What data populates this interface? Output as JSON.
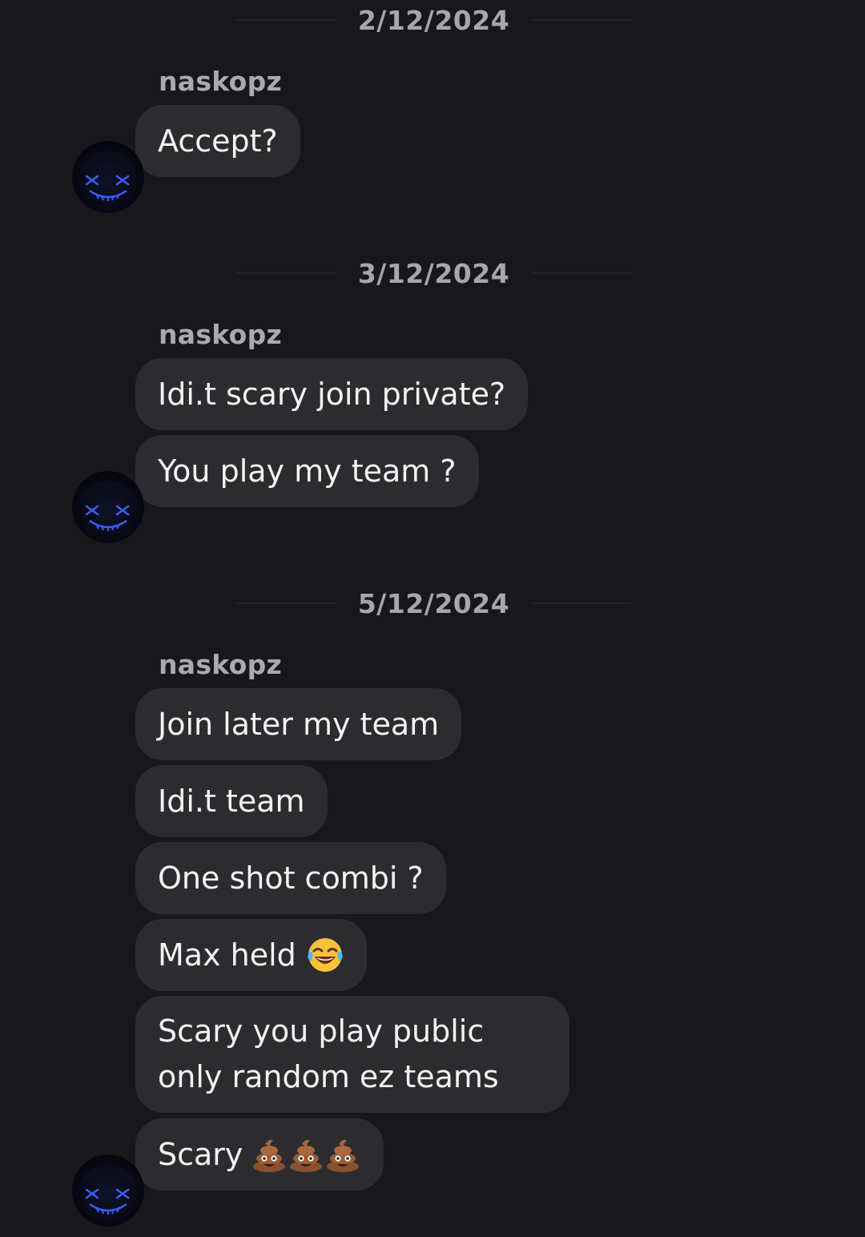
{
  "conversation": {
    "groups": [
      {
        "date": "2/12/2024",
        "sender": "naskopz",
        "messages": [
          "Accept?"
        ]
      },
      {
        "date": "3/12/2024",
        "sender": "naskopz",
        "messages": [
          "Idi.t scary join private?",
          "You play my team ?"
        ]
      },
      {
        "date": "5/12/2024",
        "sender": "naskopz",
        "messages": [
          "Join later my team",
          "Idi.t team",
          "One shot combi ?",
          "Max held",
          "Scary you play public only random ez teams",
          "Scary"
        ]
      }
    ],
    "emojis": {
      "max_held": "face-with-tears-of-joy-icon",
      "scary": [
        "pile-of-poo-icon",
        "pile-of-poo-icon",
        "pile-of-poo-icon"
      ]
    }
  }
}
